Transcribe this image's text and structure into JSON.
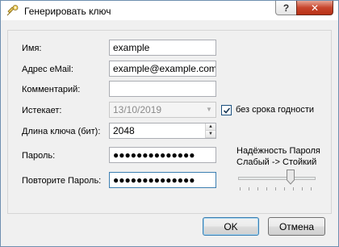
{
  "window": {
    "title": "Генерировать ключ",
    "help_label": "?",
    "close_label": "✕"
  },
  "form": {
    "name_label": "Имя:",
    "name_value": "example",
    "email_label": "Адрес eMail:",
    "email_value": "example@example.com",
    "comment_label": "Комментарий:",
    "comment_value": "",
    "expires_label": "Истекает:",
    "expires_value": "13/10/2019",
    "no_expiry_label": "без срока годности",
    "no_expiry_checked": true,
    "keylen_label": "Длина ключа (бит):",
    "keylen_value": "2048",
    "password_label": "Пароль:",
    "password_value": "●●●●●●●●●●●●●●",
    "repeat_label": "Повторите Пароль:",
    "repeat_value": "●●●●●●●●●●●●●●",
    "strength_title": "Надёжность Пароля",
    "strength_range": "Слабый -> Стойкий",
    "strength_level": 0.7
  },
  "buttons": {
    "ok": "OK",
    "cancel": "Отмена"
  },
  "colors": {
    "accent": "#3c7fb1",
    "close": "#c7452d"
  }
}
